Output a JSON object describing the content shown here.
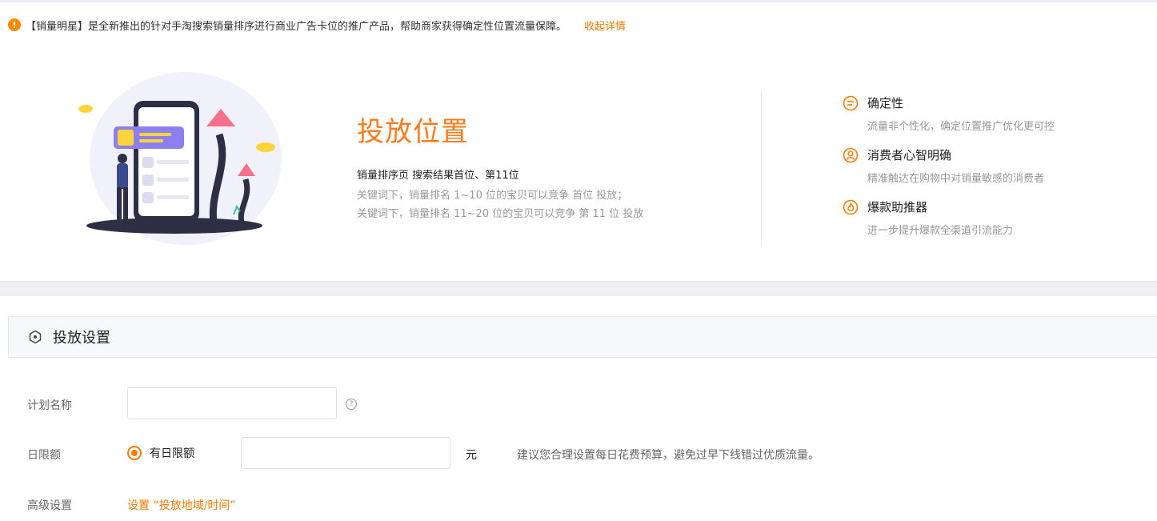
{
  "notice": {
    "icon": "info-icon",
    "text": "【销量明星】是全新推出的针对手淘搜索销量排序进行商业广告卡位的推广产品，帮助商家获得确定性位置流量保障。",
    "collapse_label": "收起详情"
  },
  "hero": {
    "title": "投放位置",
    "subtitle": "销量排序页 搜索结果首位、第11位",
    "desc_line1": "关键词下，销量排名 1~10 位的宝贝可以竞争 首位 投放；",
    "desc_line2": "关键词下，销量排名 11~20 位的宝贝可以竞争 第 11 位 投放"
  },
  "features": [
    {
      "icon": "target-list-icon",
      "title": "确定性",
      "desc": "流量非个性化，确定位置推广优化更可控"
    },
    {
      "icon": "user-icon",
      "title": "消费者心智明确",
      "desc": "精准触达在购物中对销量敏感的消费者"
    },
    {
      "icon": "fire-icon",
      "title": "爆款助推器",
      "desc": "进一步提升爆款全渠道引流能力"
    }
  ],
  "section": {
    "icon": "hexagon-icon",
    "title": "投放设置"
  },
  "form": {
    "plan_name_label": "计划名称",
    "plan_name_value": "",
    "help_icon": "?",
    "daily_limit_label": "日限额",
    "radio_label": "有日限额",
    "daily_limit_value": "",
    "unit": "元",
    "tip": "建议您合理设置每日花费预算，避免过早下线错过优质流量。",
    "advanced_label": "高级设置",
    "advanced_link": "设置 “投放地域/时间”"
  },
  "colors": {
    "accent": "#ff7a00",
    "title": "#ff7a1a"
  }
}
